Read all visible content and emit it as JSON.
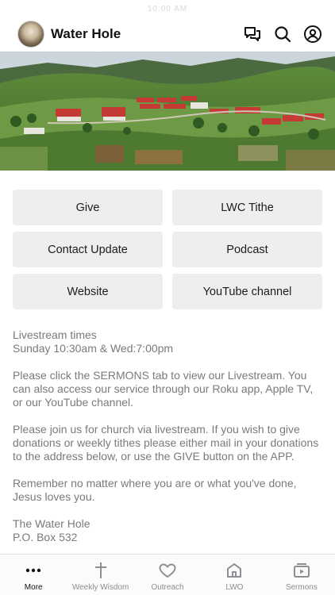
{
  "status_bar": {
    "time": "10:00 AM"
  },
  "header": {
    "title": "Water Hole",
    "icons": [
      "chat-icon",
      "search-icon",
      "profile-icon"
    ]
  },
  "buttons": [
    {
      "label": "Give"
    },
    {
      "label": "LWC Tithe"
    },
    {
      "label": "Contact Update"
    },
    {
      "label": "Podcast"
    },
    {
      "label": "Website"
    },
    {
      "label": "YouTube channel"
    }
  ],
  "info": {
    "livestream_title": "Livestream times",
    "livestream_schedule": "Sunday 10:30am &  Wed:7:00pm",
    "paragraph_1": "Please click the SERMONS tab to view our Livestream. You can also access our service through our Roku app, Apple TV, or our YouTube channel.",
    "paragraph_2": "Please join us for church via livestream. If you wish to give donations or weekly tithes please either mail in your donations to the address below, or use the GIVE button on the APP.",
    "paragraph_3": "Remember no matter where you are or what you've done, Jesus loves you.",
    "address_name": "The Water Hole",
    "address_line": "P.O. Box 532"
  },
  "tabbar": {
    "items": [
      {
        "label": "More",
        "icon": "more-icon",
        "active": true
      },
      {
        "label": "Weekly Wisdom",
        "icon": "cross-icon",
        "active": false
      },
      {
        "label": "Outreach",
        "icon": "heart-icon",
        "active": false
      },
      {
        "label": "LWO",
        "icon": "home-icon",
        "active": false
      },
      {
        "label": "Sermons",
        "icon": "video-icon",
        "active": false
      }
    ]
  },
  "colors": {
    "button_bg": "#eeeef0",
    "text_muted": "#7a7a7e",
    "tab_inactive": "#8e8e93"
  }
}
